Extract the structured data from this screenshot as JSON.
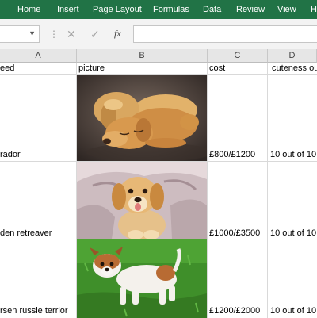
{
  "ribbon": {
    "tabs": [
      "Home",
      "Insert",
      "Page Layout",
      "Formulas",
      "Data",
      "Review",
      "View",
      "H"
    ],
    "color": "#217346"
  },
  "formula_bar": {
    "fx_label": "fx",
    "cancel_icon": "✕",
    "enter_icon": "✓",
    "separator": "⋮"
  },
  "columns": [
    "A",
    "B",
    "C",
    "D"
  ],
  "headers": [
    "eed",
    "picture",
    "cost",
    "cuteness ou"
  ],
  "rows": [
    {
      "breed": "rador",
      "cost": "£800/£1200",
      "cuteness": "10 out of 10"
    },
    {
      "breed": "den retreaver",
      "cost": "£1000/£3500",
      "cuteness": "10 out of 10"
    },
    {
      "breed": "rsen russle terrior",
      "cost": "£1200/£2000",
      "cuteness": "10 out of 10"
    }
  ]
}
